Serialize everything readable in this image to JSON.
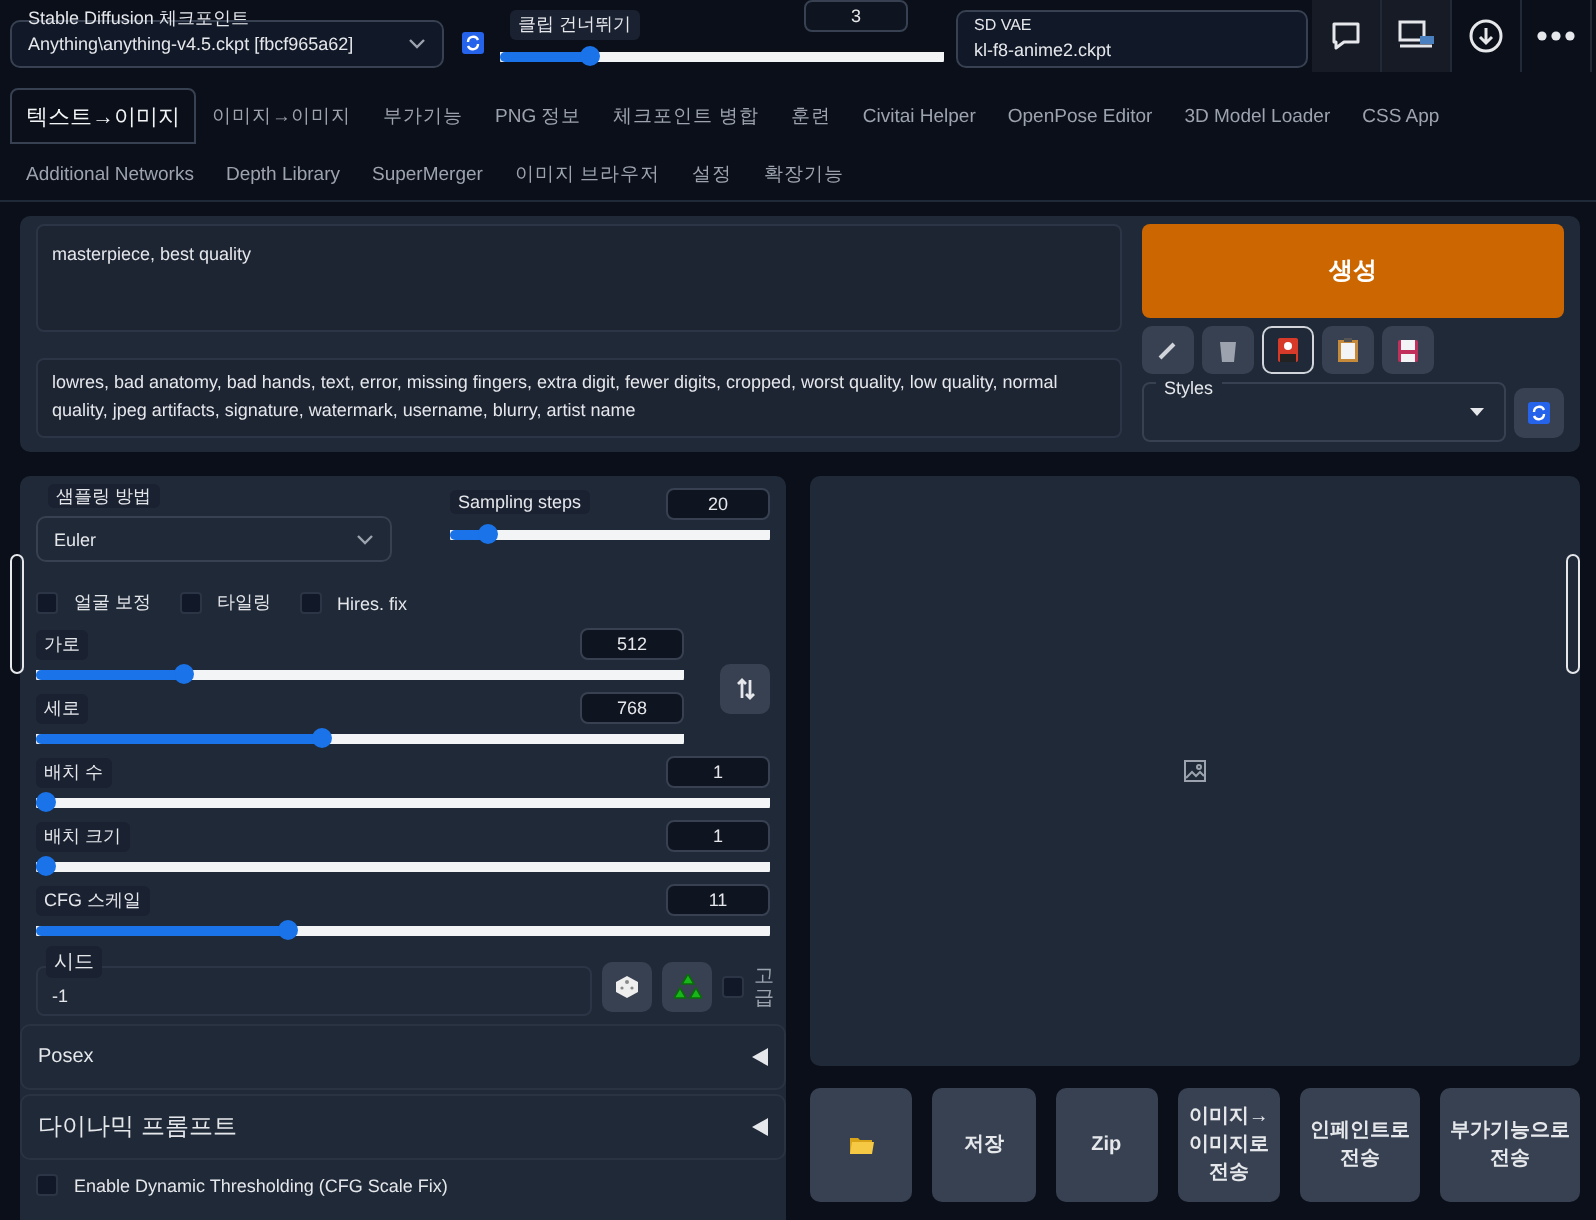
{
  "top_bar": {
    "checkpoint": {
      "label": "Stable Diffusion 체크포인트",
      "value": "Anything\\anything-v4.5.ckpt [fbcf965a62]"
    },
    "clip_skip": {
      "label": "클립 건너뛰기",
      "value": "3",
      "level": 0.19
    },
    "vae": {
      "label": "SD VAE",
      "value": "kl-f8-anime2.ckpt"
    },
    "icon_buttons": [
      {
        "kind": "chat"
      },
      {
        "kind": "monitor"
      },
      {
        "kind": "download"
      },
      {
        "kind": "more"
      }
    ]
  },
  "tabs": [
    {
      "label": "텍스트→이미지",
      "selected": true
    },
    {
      "label": "이미지→이미지",
      "selected": false
    },
    {
      "label": "부가기능",
      "selected": false
    },
    {
      "label": "PNG 정보",
      "selected": false
    },
    {
      "label": "체크포인트 병합",
      "selected": false
    },
    {
      "label": "훈련",
      "selected": false
    },
    {
      "label": "Civitai Helper",
      "selected": false
    },
    {
      "label": "OpenPose Editor",
      "selected": false
    },
    {
      "label": "3D Model Loader",
      "selected": false
    },
    {
      "label": "CSS App",
      "selected": false
    },
    {
      "label": "Additional Networks",
      "selected": false
    },
    {
      "label": "Depth Library",
      "selected": false
    },
    {
      "label": "SuperMerger",
      "selected": false
    },
    {
      "label": "이미지 브라우저",
      "selected": false
    },
    {
      "label": "설정",
      "selected": false
    },
    {
      "label": "확장기능",
      "selected": false
    }
  ],
  "prompt": {
    "positive": "masterpiece, best quality",
    "negative": "lowres, bad anatomy, bad hands, text, error, missing fingers, extra digit, fewer digits, cropped, worst quality, low quality, normal quality, jpeg artifacts, signature, watermark, username, blurry, artist name"
  },
  "generate_button": "생성",
  "tool_buttons": [
    {
      "kind": "pencil",
      "selected": false
    },
    {
      "kind": "trash",
      "selected": false
    },
    {
      "kind": "card",
      "selected": true
    },
    {
      "kind": "clipboard",
      "selected": false
    },
    {
      "kind": "floppy",
      "selected": false
    }
  ],
  "styles": {
    "label": "Styles"
  },
  "settings": {
    "sampler": {
      "label": "샘플링 방법",
      "value": "Euler"
    },
    "steps": {
      "label": "Sampling steps",
      "value": "20",
      "level": 0.09
    },
    "checkboxes": [
      {
        "label": "얼굴 보정",
        "checked": false
      },
      {
        "label": "타일링",
        "checked": false
      },
      {
        "label": "Hires. fix",
        "checked": false
      }
    ],
    "size_sliders": [
      {
        "label": "가로",
        "value": "512",
        "level": 0.22
      },
      {
        "label": "세로",
        "value": "768",
        "level": 0.44
      }
    ],
    "sliders": [
      {
        "label": "배치 수",
        "value": "1",
        "level": 0
      },
      {
        "label": "배치 크기",
        "value": "1",
        "level": 0
      },
      {
        "label": "CFG 스케일",
        "value": "11",
        "level": 0.34
      }
    ],
    "seed": {
      "label": "시드",
      "value": "-1",
      "extra_label": "고급",
      "extra_checked": false
    }
  },
  "accordions": [
    {
      "label": "Posex",
      "expanded": false
    },
    {
      "label": "다이나믹 프롬프트",
      "expanded": false
    }
  ],
  "dynamic_thresholding": {
    "label": "Enable Dynamic Thresholding (CFG Scale Fix)",
    "checked": false
  },
  "output_buttons": [
    {
      "kind": "folder"
    },
    {
      "kind": "text",
      "label": "저장"
    },
    {
      "kind": "text",
      "label": "Zip"
    },
    {
      "kind": "text",
      "label": "이미지→이미지로 전송"
    },
    {
      "kind": "text",
      "label": "인페인트로 전송"
    },
    {
      "kind": "text",
      "label": "부가기능으로 전송"
    }
  ]
}
